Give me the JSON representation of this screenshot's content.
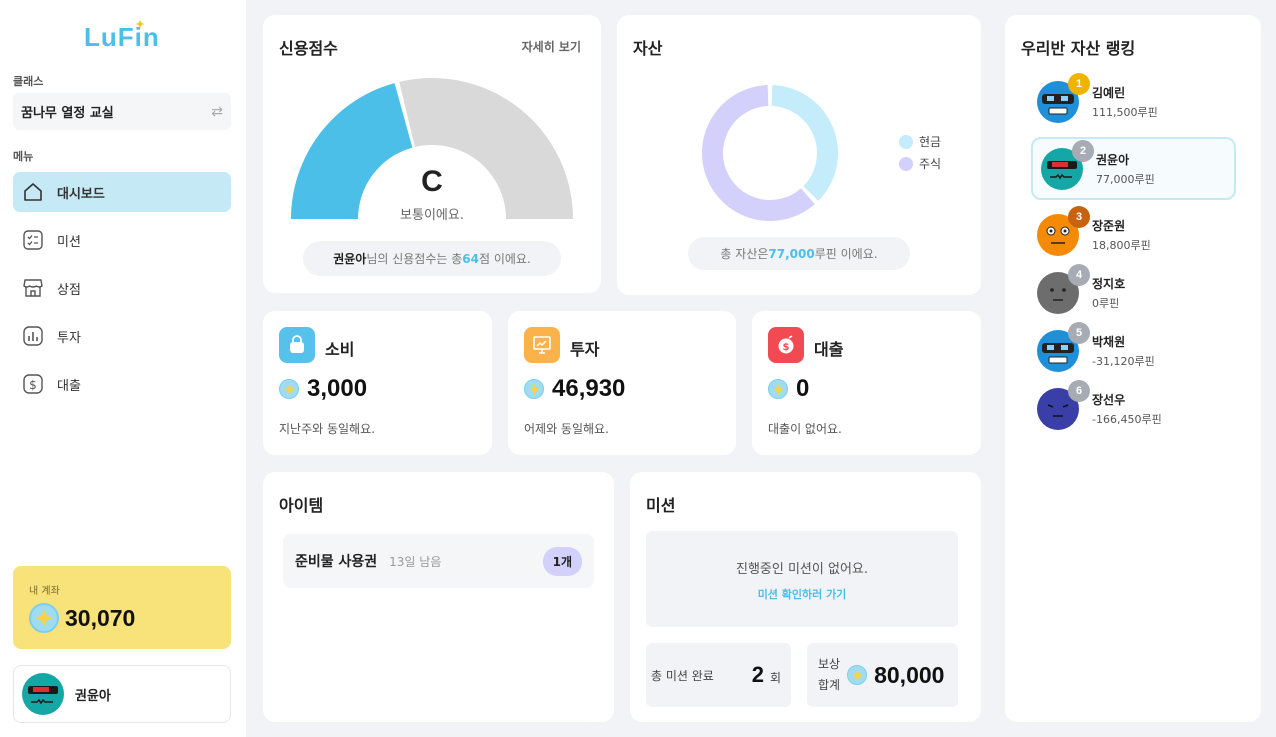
{
  "app": {
    "logo": "LuFin"
  },
  "sidebar": {
    "class_label": "클래스",
    "class_name": "꿈나무 열정 교실",
    "menu_label": "메뉴",
    "items": [
      {
        "label": "대시보드",
        "icon": "home-icon",
        "active": true
      },
      {
        "label": "미션",
        "icon": "checklist-icon",
        "active": false
      },
      {
        "label": "상점",
        "icon": "store-icon",
        "active": false
      },
      {
        "label": "투자",
        "icon": "chart-icon",
        "active": false
      },
      {
        "label": "대출",
        "icon": "dollar-icon",
        "active": false
      }
    ],
    "account": {
      "label": "내 계좌",
      "amount": "30,070"
    },
    "profile": {
      "name": "권윤아"
    }
  },
  "credit": {
    "title": "신용점수",
    "detail_link": "자세히 보기",
    "grade": "C",
    "grade_desc": "보통이에요.",
    "gauge_fraction": 0.42,
    "summary_name": "권윤아",
    "summary_pre": " 님의 신용점수는 총 ",
    "score": "64",
    "summary_post": " 점 이에요."
  },
  "assets": {
    "title": "자산",
    "legend": [
      {
        "label": "현금",
        "color": "#c4ecfa",
        "fraction": 0.38
      },
      {
        "label": "주식",
        "color": "#d3d0fb",
        "fraction": 0.62
      }
    ],
    "summary_pre": "총 자산은 ",
    "total": "77,000",
    "summary_post": " 루핀 이에요."
  },
  "stats": [
    {
      "title": "소비",
      "value": "3,000",
      "note": "지난주와 동일해요.",
      "icon": "shopping-bag-icon",
      "color": "#56c1ea"
    },
    {
      "title": "투자",
      "value": "46,930",
      "note": "어제와 동일해요.",
      "icon": "presentation-chart-icon",
      "color": "#fbb24a"
    },
    {
      "title": "대출",
      "value": "0",
      "note": "대출이 없어요.",
      "icon": "money-bag-icon",
      "color": "#f24a52"
    }
  ],
  "items": {
    "title": "아이템",
    "list": [
      {
        "name": "준비물 사용권",
        "remaining": "13일 남음",
        "count": "1개"
      }
    ]
  },
  "missions": {
    "title": "미션",
    "empty_text": "진행중인 미션이 없어요.",
    "link": "미션 확인하러 가기",
    "completed_label": "총 미션 완료",
    "completed_count": "2",
    "completed_unit": "회",
    "reward_label_1": "보상",
    "reward_label_2": "합계",
    "reward_total": "80,000"
  },
  "ranking": {
    "title": "우리반 자산 랭킹",
    "list": [
      {
        "rank": "1",
        "name": "김예린",
        "amount": "111,500루핀",
        "badge_color": "#f0b400",
        "avatar": "robot-blue"
      },
      {
        "rank": "2",
        "name": "권윤아",
        "amount": "77,000루핀",
        "badge_color": "#a7acb4",
        "avatar": "teal-visor",
        "me": true
      },
      {
        "rank": "3",
        "name": "장준원",
        "amount": "18,800루핀",
        "badge_color": "#c8620e",
        "avatar": "orange-face"
      },
      {
        "rank": "4",
        "name": "정지호",
        "amount": "0루핀",
        "badge_color": "#a7acb4",
        "avatar": "gray-face"
      },
      {
        "rank": "5",
        "name": "박채원",
        "amount": "-31,120루핀",
        "badge_color": "#a7acb4",
        "avatar": "robot-blue"
      },
      {
        "rank": "6",
        "name": "장선우",
        "amount": "-166,450루핀",
        "badge_color": "#a7acb4",
        "avatar": "indigo-face"
      }
    ]
  }
}
